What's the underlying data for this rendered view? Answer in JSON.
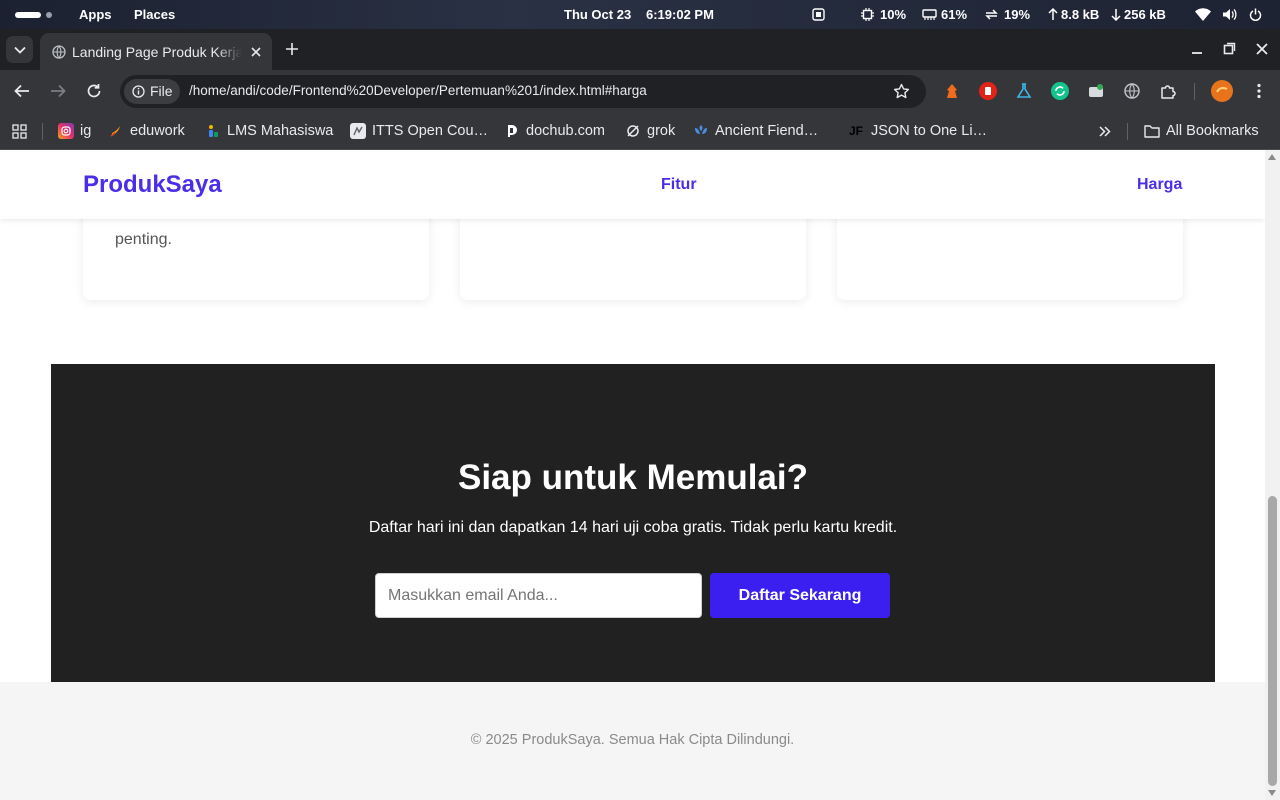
{
  "system_bar": {
    "apps": "Apps",
    "places": "Places",
    "date": "Thu Oct 23",
    "time": "6:19:02 PM",
    "cpu": "10%",
    "memory": "61%",
    "swap": "19%",
    "upload": "8.8 kB",
    "download": "256 kB"
  },
  "browser": {
    "tab_title": "Landing Page Produk Kerja",
    "url_scheme_label": "File",
    "url": "/home/andi/code/Frontend%20Developer/Pertemuan%201/index.html#harga",
    "bookmarks": [
      {
        "label": "ig"
      },
      {
        "label": "eduwork"
      },
      {
        "label": "LMS Mahasiswa"
      },
      {
        "label": "ITTS Open Cou…"
      },
      {
        "label": "dochub.com"
      },
      {
        "label": "grok"
      },
      {
        "label": "Ancient Fiend…"
      },
      {
        "label": "JSON to One Li…"
      }
    ],
    "all_bookmarks": "All Bookmarks"
  },
  "page": {
    "brand": "ProdukSaya",
    "nav": {
      "fitur": "Fitur",
      "harga": "Harga"
    },
    "card1_text": "penting.",
    "cta": {
      "title": "Siap untuk Memulai?",
      "subtitle": "Daftar hari ini dan dapatkan 14 hari uji coba gratis. Tidak perlu kartu kredit.",
      "email_placeholder": "Masukkan email Anda...",
      "button": "Daftar Sekarang"
    },
    "footer": "© 2025 ProdukSaya. Semua Hak Cipta Dilindungi."
  },
  "colors": {
    "brand": "#4a2ee8",
    "cta_bg": "#212121",
    "button": "#3b1ff0"
  }
}
